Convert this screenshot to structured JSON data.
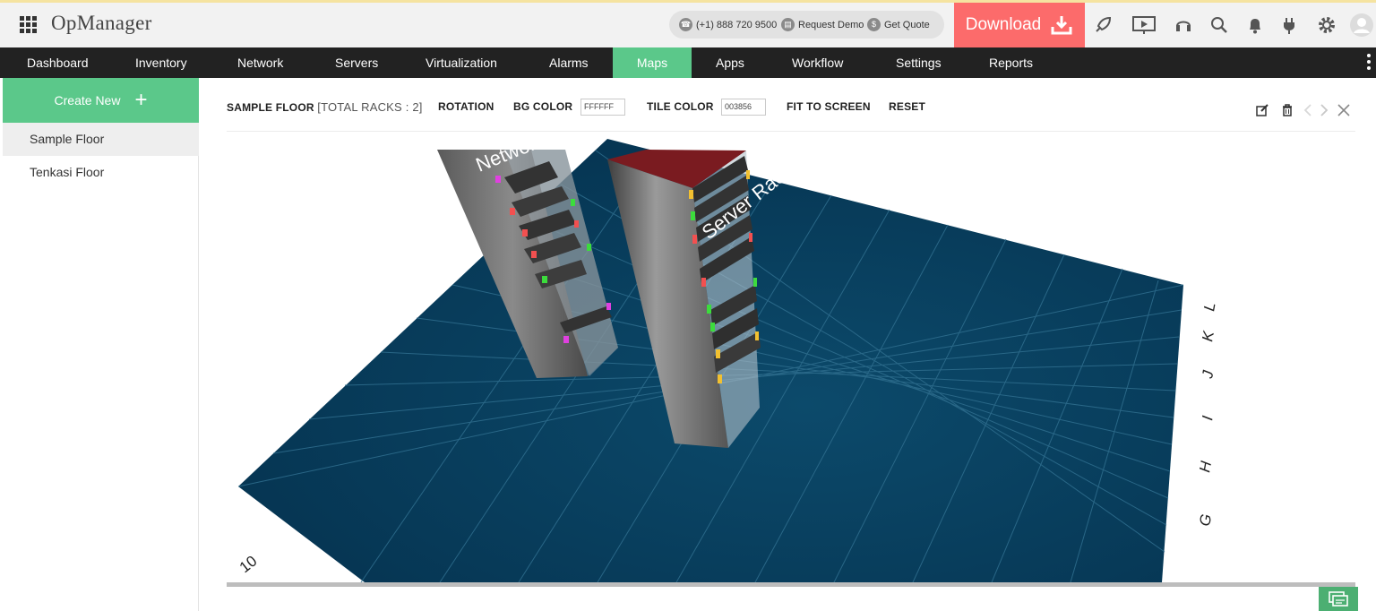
{
  "header": {
    "app_title": "OpManager",
    "phone": "(+1) 888 720 9500",
    "request_demo": "Request Demo",
    "get_quote": "Get Quote",
    "download_label": "Download",
    "download_color": "#fc6b6b"
  },
  "nav": {
    "items": [
      {
        "label": "Dashboard"
      },
      {
        "label": "Inventory"
      },
      {
        "label": "Network"
      },
      {
        "label": "Servers"
      },
      {
        "label": "Virtualization"
      },
      {
        "label": "Alarms"
      },
      {
        "label": "Maps",
        "active": true
      },
      {
        "label": "Apps"
      },
      {
        "label": "Workflow"
      },
      {
        "label": "Settings"
      },
      {
        "label": "Reports"
      }
    ],
    "active_color": "#5bc88a"
  },
  "sidebar": {
    "create_label": "Create New",
    "floors": [
      {
        "label": "Sample Floor",
        "selected": true
      },
      {
        "label": "Tenkasi Floor"
      }
    ]
  },
  "toolbar": {
    "floor_name": "SAMPLE FLOOR",
    "total_racks": "[TOTAL RACKS : 2]",
    "rotation": "ROTATION",
    "bg_color_label": "BG COLOR",
    "bg_color_value": "FFFFFF",
    "tile_color_label": "TILE COLOR",
    "tile_color_value": "003856",
    "fit_to_screen": "FIT TO SCREEN",
    "reset": "RESET"
  },
  "view": {
    "tile_color": "#003856",
    "rack_labels": [
      "Network",
      "Server Rack"
    ],
    "row_labels": [
      "G",
      "H",
      "I",
      "J",
      "K",
      "L"
    ],
    "column_label": "10"
  }
}
